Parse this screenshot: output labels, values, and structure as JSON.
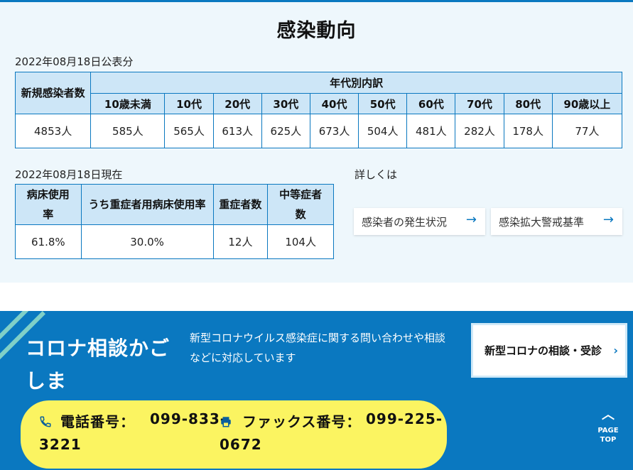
{
  "section": {
    "title": "感染動向"
  },
  "infections": {
    "date": "2022年08月18日公表分",
    "new_label": "新規感染者数",
    "breakdown_label": "年代別内訳",
    "ages": [
      "10歳未満",
      "10代",
      "20代",
      "30代",
      "40代",
      "50代",
      "60代",
      "70代",
      "80代",
      "90歳以上"
    ],
    "total": "4853人",
    "values": [
      "585人",
      "565人",
      "613人",
      "625人",
      "673人",
      "504人",
      "481人",
      "282人",
      "178人",
      "77人"
    ]
  },
  "beds": {
    "date": "2022年08月18日現在",
    "headers": [
      "病床使用率",
      "うち重症者用病床使用率",
      "重症者数",
      "中等症者数"
    ],
    "values": [
      "61.8%",
      "30.0%",
      "12人",
      "104人"
    ]
  },
  "details": {
    "label": "詳しくは",
    "links": [
      "感染者の発生状況",
      "感染拡大警戒基準"
    ]
  },
  "consult": {
    "title": "コロナ相談かごしま",
    "desc": "新型コロナウイルス感染症に関する問い合わせや相談などに対応しています",
    "button": "新型コロナの相談・受診",
    "phone_label": "電話番号：",
    "phone": "099-833-3221",
    "fax_label": "ファックス番号：",
    "fax": "099-225-0672"
  },
  "page_top": {
    "label1": "PAGE",
    "label2": "TOP"
  },
  "colors": {
    "accent": "#0a78c0",
    "header_bg": "#cde6f7",
    "contact_bg": "#fbf461",
    "section_bg": "#eef7fc"
  }
}
